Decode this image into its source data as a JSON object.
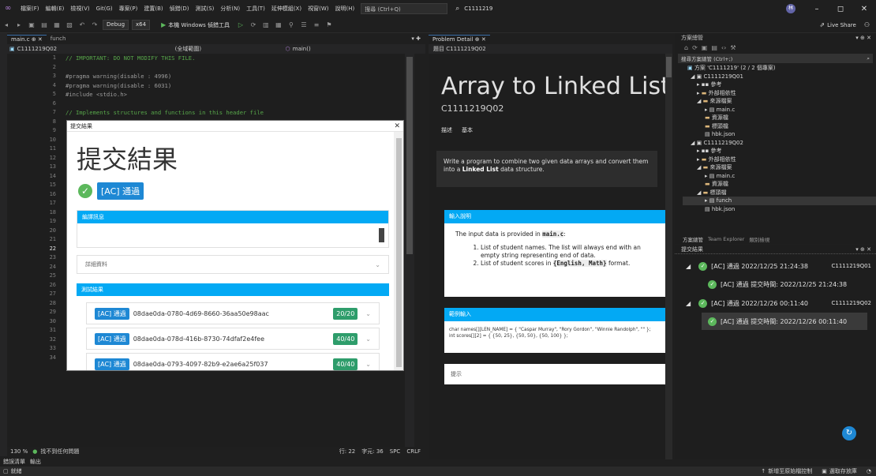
{
  "menu": {
    "items": [
      "檔案(F)",
      "編輯(E)",
      "檢視(V)",
      "Git(G)",
      "專案(P)",
      "建置(B)",
      "偵錯(D)",
      "測試(S)",
      "分析(N)",
      "工具(T)",
      "延伸模組(X)",
      "視窗(W)",
      "說明(H)"
    ],
    "search_placeholder": "搜尋 (Ctrl+Q)",
    "window_title": "C1111219",
    "live_share": "Live Share"
  },
  "toolbar": {
    "config": "Debug",
    "platform": "x64",
    "run_label": "本機 Windows 偵錯工具"
  },
  "editor": {
    "tabs": [
      "main.c",
      "funch"
    ],
    "nav_project": "C1111219Q02",
    "nav_scope": "(全域範圍)",
    "nav_func": "main()",
    "line_numbers": [
      "1",
      "2",
      "3",
      "4",
      "5",
      "6",
      "7",
      "8",
      "9",
      "10",
      "11",
      "12",
      "13",
      "14",
      "15",
      "16",
      "17",
      "18",
      "19",
      "20",
      "21",
      "22",
      "23",
      "24",
      "25",
      "26",
      "27",
      "28",
      "29",
      "30",
      "31",
      "32",
      "33",
      "34"
    ],
    "code": {
      "l1": "// IMPORTANT: DO NOT MODIFY THIS FILE.",
      "l3": "#pragma warning(disable : 4996)",
      "l4": "#pragma warning(disable : 6031)",
      "l5": "#include <stdio.h>",
      "l7": "// Implements structures and functions in this header file"
    },
    "stray_text": "};",
    "zoom": "130 %",
    "no_issues": "找不到任何問題",
    "cursor_pos": "行: 22",
    "char_pos": "字元: 36",
    "spc": "SPC",
    "crlf": "CRLF"
  },
  "bottom_tabs": [
    "錯誤清單",
    "輸出"
  ],
  "status": {
    "ready": "就緒",
    "add_source": "新增至原始檔控制",
    "select_repo": "選取存放庫"
  },
  "dialog": {
    "title": "提交結果",
    "heading": "提交結果",
    "result_badge": "[AC] 通過",
    "compile_section": "編譯訊息",
    "detail_section": "詳細資料",
    "test_section": "測試結果",
    "cases": [
      {
        "badge": "[AC] 通過",
        "id": "08dae0da-0780-4d69-8660-36aa50e98aac",
        "score": "20/20"
      },
      {
        "badge": "[AC] 通過",
        "id": "08dae0da-078d-416b-8730-74dfaf2e4fee",
        "score": "40/40"
      },
      {
        "badge": "[AC] 通過",
        "id": "08dae0da-0793-4097-82b9-e2ae6a25f037",
        "score": "40/40"
      }
    ]
  },
  "problem": {
    "tab": "Problem Detail",
    "breadcrumb": "題目 C1111219Q02",
    "title": "Array to Linked List",
    "code": "C1111219Q02",
    "tabs": [
      "描述",
      "基本"
    ],
    "desc_before": "Write a program to combine two given data arrays and convert them into a ",
    "desc_bold": "Linked List",
    "desc_after": " data structure.",
    "input_head": "輸入說明",
    "input_before": "The input data is provided in ",
    "input_code": "main.c",
    "input_after": ":",
    "input_item1": "List of student names. The list will always end with an empty string representing end of data.",
    "input_item2_before": "List of student scores in ",
    "input_item2_code": "{English, Math}",
    "input_item2_after": " format.",
    "sample_head": "範例輸入",
    "sample_line1": "char names[][LEN_NAME] = { \"Caspar Murray\", \"Rory Gordon\", \"Winnie Randolph\", \"\" };",
    "sample_line2": "int scores[][2] = { {50, 25}, {50, 50}, {50, 100} };",
    "hint_head": "提示"
  },
  "solution": {
    "title": "方案總管",
    "search": "搜尋方案總管 (Ctrl+;)",
    "items": [
      "方案 'C1111219' (2 / 2 個專案)",
      "C1111219Q01",
      "參考",
      "外部相依性",
      "來源檔案",
      "main.c",
      "資源檔",
      "標頭檔",
      "hbk.json",
      "C1111219Q02",
      "參考",
      "外部相依性",
      "來源檔案",
      "main.c",
      "資源檔",
      "標頭檔",
      "funch",
      "hbk.json"
    ],
    "bottom_tabs": [
      "方案總管",
      "Team Explorer",
      "類別檢視"
    ]
  },
  "submissions": {
    "title": "提交結果",
    "rows": [
      {
        "text": "[AC] 通過 2022/12/25 21:24:38",
        "project": "C1111219Q01"
      },
      {
        "text": "[AC] 通過 提交時間: 2022/12/25 21:24:38",
        "project": ""
      },
      {
        "text": "[AC] 通過 2022/12/26 00:11:40",
        "project": "C1111219Q02"
      },
      {
        "text": "[AC] 通過 提交時間: 2022/12/26 00:11:40",
        "project": ""
      }
    ]
  },
  "colors": {
    "accent": "#03a9f4",
    "ac_badge": "#1e88d4",
    "score": "#2e9d6b",
    "check": "#5cb85c"
  }
}
